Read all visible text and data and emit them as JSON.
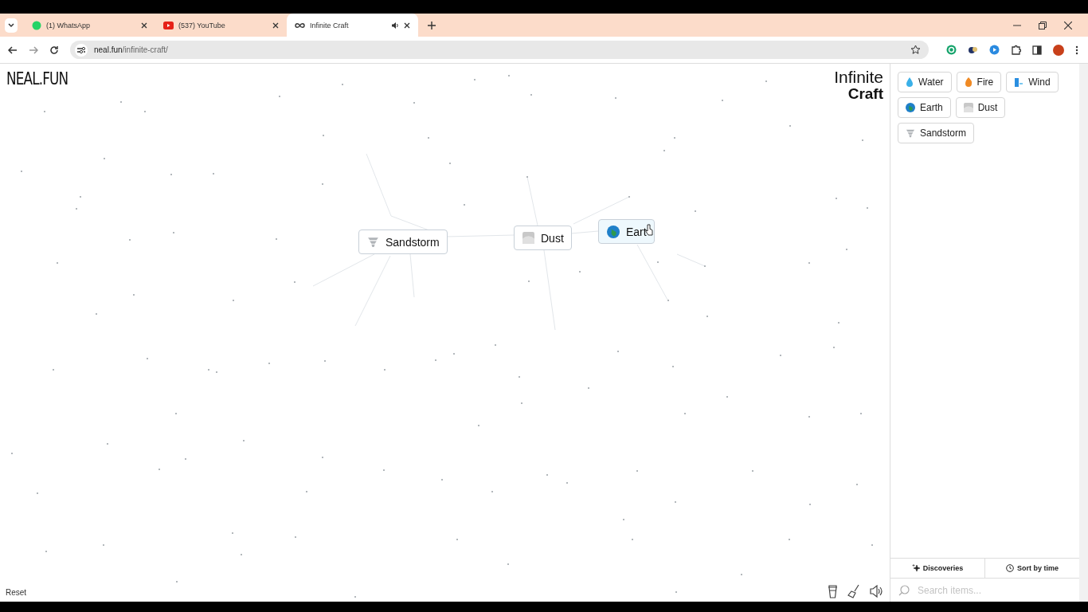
{
  "browser": {
    "tabs": [
      {
        "title": "(1) WhatsApp",
        "kind": "chat",
        "selected": false
      },
      {
        "title": "(537) YouTube",
        "kind": "video",
        "selected": false
      },
      {
        "title": "Infinite Craft",
        "kind": "loop",
        "selected": true
      }
    ],
    "url_host": "neal.fun",
    "url_path": "/infinite-craft/"
  },
  "site_logo": "NEAL.FUN",
  "game_title": [
    "Infinite",
    "Craft"
  ],
  "canvas_items": [
    {
      "label": "Sandstorm",
      "kind": "tornado"
    },
    {
      "label": "Dust",
      "kind": "dust"
    },
    {
      "label": "Eart",
      "kind": "globe"
    }
  ],
  "reset": "Reset",
  "sidebar": {
    "items": [
      {
        "label": "Water",
        "kind": "drop"
      },
      {
        "label": "Fire",
        "kind": "flame"
      },
      {
        "label": "Wind",
        "kind": "wind"
      },
      {
        "label": "Earth",
        "kind": "globe"
      },
      {
        "label": "Dust",
        "kind": "dust"
      },
      {
        "label": "Sandstorm",
        "kind": "tornado"
      }
    ],
    "discoveries": "Discoveries",
    "sort": "Sort by time",
    "search": {
      "placeholder": "Search items..."
    }
  }
}
